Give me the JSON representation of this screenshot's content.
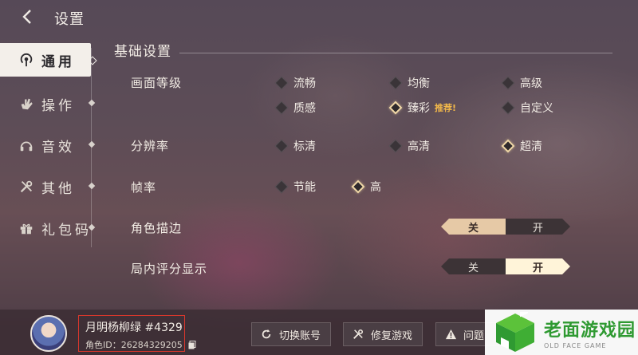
{
  "header": {
    "title": "设置"
  },
  "sidebar": {
    "items": [
      {
        "label": "通用",
        "icon": "signal-icon",
        "active": true
      },
      {
        "label": "操作",
        "icon": "hand-icon",
        "active": false
      },
      {
        "label": "音效",
        "icon": "headphones-icon",
        "active": false
      },
      {
        "label": "其他",
        "icon": "tools-icon",
        "active": false
      },
      {
        "label": "礼包码",
        "icon": "gift-icon",
        "active": false
      }
    ]
  },
  "main": {
    "section_title": "基础设置",
    "quality": {
      "label": "画面等级",
      "options": [
        "流畅",
        "均衡",
        "高级",
        "质感",
        "臻彩",
        "自定义"
      ],
      "selected": "臻彩",
      "recommend_badge": "推荐!"
    },
    "resolution": {
      "label": "分辨率",
      "options": [
        "标清",
        "高清",
        "超清"
      ],
      "selected": "超清"
    },
    "framerate": {
      "label": "帧率",
      "options": [
        "节能",
        "高"
      ],
      "selected": "高"
    },
    "outline": {
      "label": "角色描边",
      "off": "关",
      "on": "开",
      "state": "off"
    },
    "score_display": {
      "label": "局内评分显示",
      "off": "关",
      "on": "开",
      "state": "on"
    }
  },
  "footer": {
    "username": "月明杨柳绿 #4329",
    "user_id": "角色ID：26284329205",
    "buttons": [
      "切换账号",
      "修复游戏",
      "问题"
    ]
  },
  "watermark": {
    "main": "老面游戏园",
    "sub": "OLD FACE GAME"
  },
  "colors": {
    "accent": "#f2d9a8",
    "highlight_box": "#d8372c",
    "watermark_green": "#2f9a32"
  }
}
